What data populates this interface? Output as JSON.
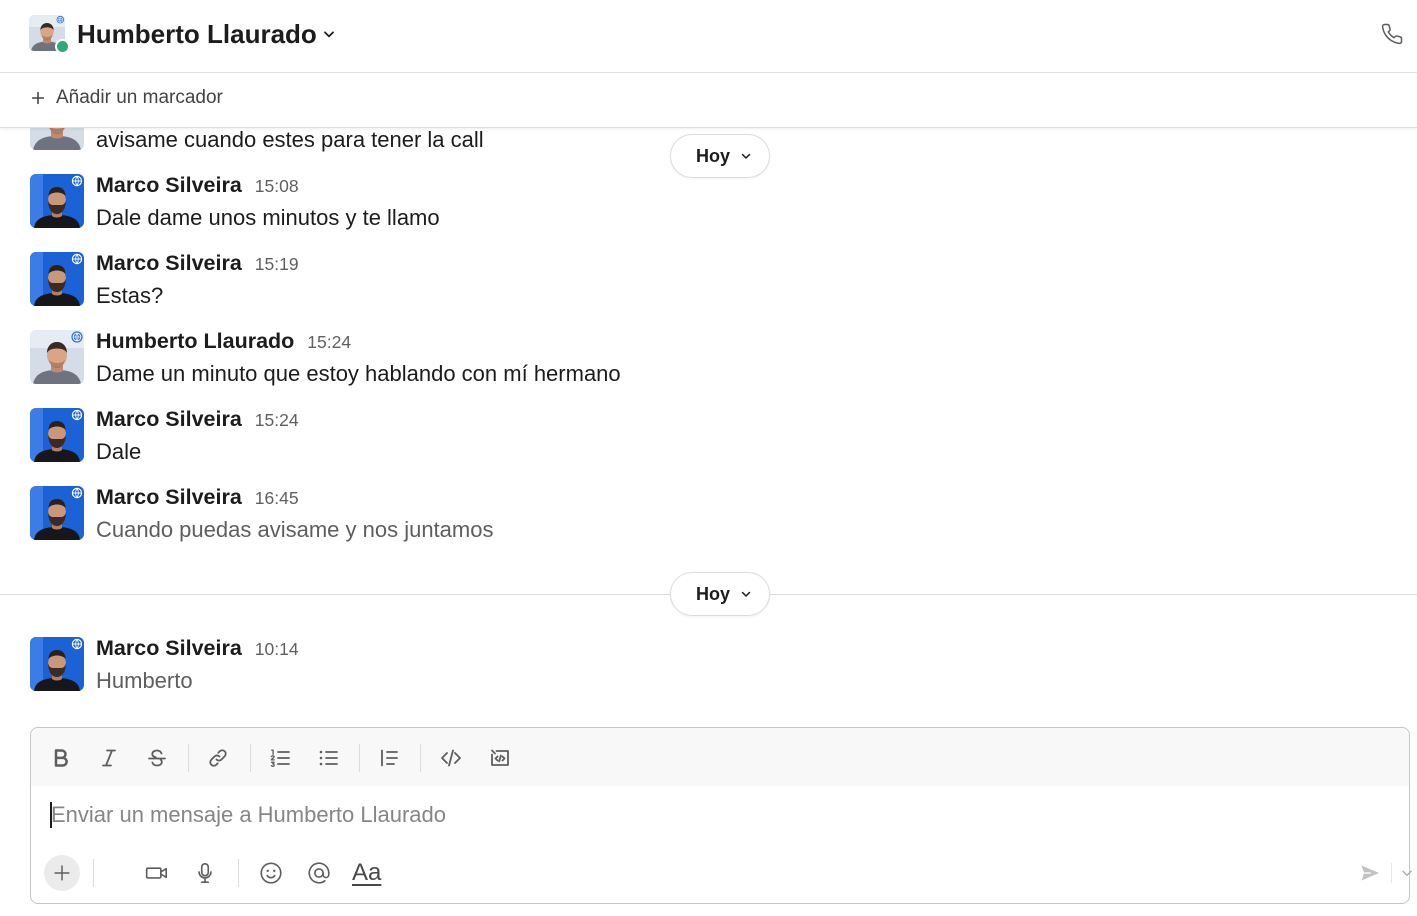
{
  "header": {
    "title": "Humberto Llaurado",
    "presence_icon": "online-status-dot",
    "title_icon": "chevron-down-icon",
    "call_icon": "phone-icon"
  },
  "bookmarks": {
    "add_label": "Añadir un marcador",
    "add_icon": "plus-icon"
  },
  "partial_message": {
    "text": "avisame cuando estes para tener la call"
  },
  "date_dividers": [
    {
      "label": "Hoy"
    },
    {
      "label": "Hoy"
    }
  ],
  "messages": [
    {
      "author": "Marco Silveira",
      "time": "15:08",
      "text": "Dale dame unos minutos y te llamo"
    },
    {
      "author": "Marco Silveira",
      "time": "15:19",
      "text": "Estas?"
    },
    {
      "author": "Humberto Llaurado",
      "time": "15:24",
      "text": "Dame un minuto que estoy hablando con mí hermano"
    },
    {
      "author": "Marco Silveira",
      "time": "15:24",
      "text": "Dale"
    },
    {
      "author": "Marco Silveira",
      "time": "16:45",
      "text": "Cuando puedas avisame y nos juntamos"
    },
    {
      "author": "Marco Silveira",
      "time": "10:14",
      "text": "Humberto"
    }
  ],
  "composer": {
    "placeholder": "Enviar un mensaje a Humberto Llaurado",
    "formatting_toggle_label": "Aa",
    "toolbar_icons": [
      "bold-icon",
      "italic-icon",
      "strikethrough-icon",
      "link-icon",
      "ordered-list-icon",
      "bullet-list-icon",
      "blockquote-icon",
      "code-icon",
      "code-block-icon"
    ],
    "action_icons": [
      "plus-icon",
      "video-icon",
      "microphone-icon",
      "emoji-icon",
      "mention-icon",
      "send-icon",
      "chevron-down-icon"
    ]
  },
  "colors": {
    "presence_online": "#2bac76",
    "text_primary": "#1d1c1d",
    "text_secondary": "#616061",
    "placeholder": "#868686",
    "toolbar_background": "#f8f8f8"
  }
}
